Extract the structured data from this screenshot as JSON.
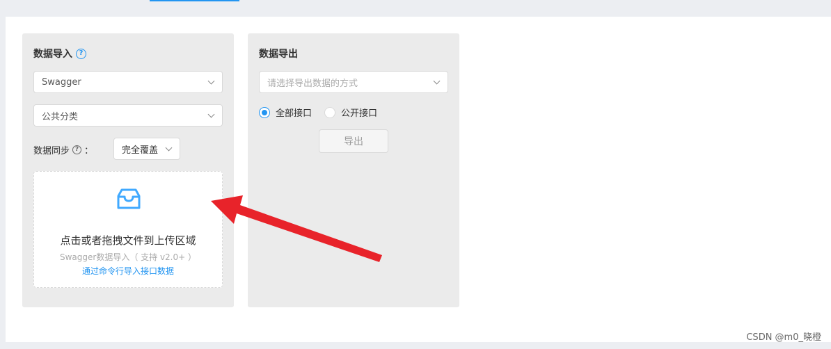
{
  "import_panel": {
    "title": "数据导入",
    "help_icon": "question-circle-icon",
    "type_select": {
      "value": "Swagger"
    },
    "category_select": {
      "value": "公共分类"
    },
    "sync": {
      "label": "数据同步",
      "colon": "：",
      "value": "完全覆盖"
    },
    "dropzone": {
      "icon": "inbox-icon",
      "main_text": "点击或者拖拽文件到上传区域",
      "sub_text": "Swagger数据导入（ 支持 v2.0+ ）",
      "link_text": "通过命令行导入接口数据"
    }
  },
  "export_panel": {
    "title": "数据导出",
    "method_select": {
      "placeholder": "请选择导出数据的方式"
    },
    "radio_all": {
      "label": "全部接口",
      "checked": true
    },
    "radio_public": {
      "label": "公开接口",
      "checked": false
    },
    "export_button": "导出"
  },
  "watermark": "CSDN @m0_晓橙",
  "colors": {
    "accent": "#2395f1",
    "panel_bg": "#ebebeb",
    "annotation_arrow": "#e8232a"
  }
}
